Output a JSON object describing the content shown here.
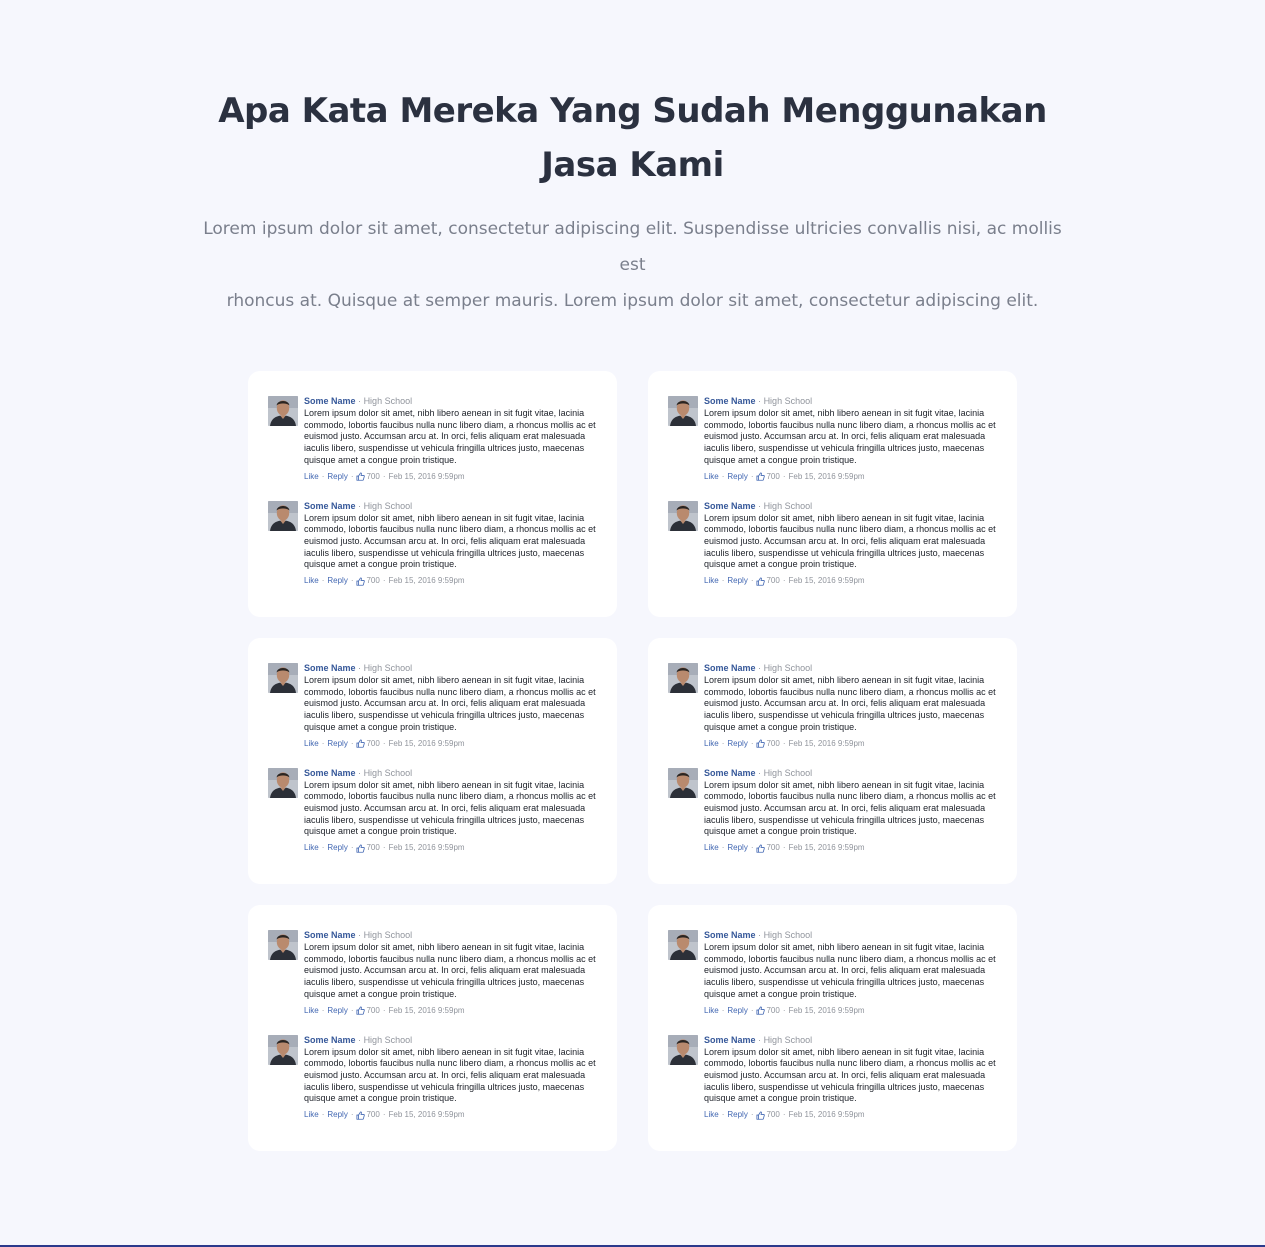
{
  "section": {
    "heading_line1": "Apa Kata Mereka Yang Sudah Menggunakan",
    "heading_line2": "Jasa Kami",
    "intro_line1": "Lorem ipsum dolor sit amet, consectetur adipiscing elit. Suspendisse ultricies convallis nisi, ac mollis est",
    "intro_line2": "rhoncus at. Quisque at semper mauris. Lorem ipsum dolor sit amet, consectetur adipiscing elit."
  },
  "comment": {
    "author": "Some Name",
    "affiliation": "High School",
    "dot": "·",
    "text": "Lorem ipsum dolor sit amet, nibh libero aenean in sit fugit vitae, lacinia commodo, lobortis faucibus nulla nunc libero diam, a rhoncus mollis ac et euismod justo. Accumsan arcu at. In orci, felis aliquam erat malesuada iaculis libero, suspendisse ut vehicula fringilla ultrices justo, maecenas quisque amet a congue proin tristique.",
    "like_label": "Like",
    "reply_label": "Reply",
    "like_count": "700",
    "timestamp": "Feb 15, 2016 9:59pm",
    "thumb_icon": "thumbs-up-icon",
    "avatar_icon": "user-photo-icon"
  },
  "layout_counts": {
    "cards": 6,
    "comments_per_card": 2
  },
  "colors": {
    "background": "#f6f7fd",
    "heading": "#2b3140",
    "intro": "#7a7f8c",
    "author_link": "#365899",
    "action_link": "#4267b2",
    "meta": "#90949c",
    "body_text": "#1d2129",
    "bottom_line": "#2b3a8c"
  }
}
